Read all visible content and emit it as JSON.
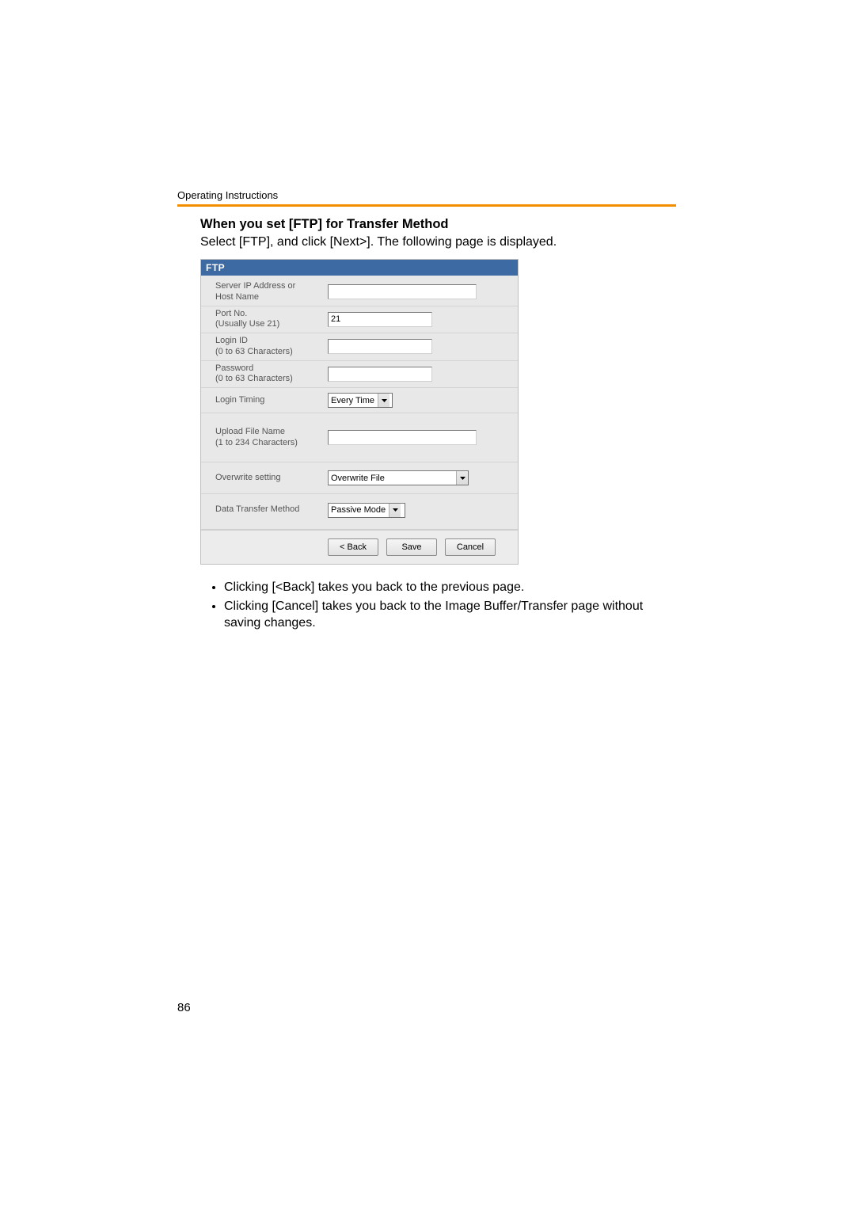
{
  "header": {
    "running_head": "Operating Instructions"
  },
  "section": {
    "title": "When you set [FTP] for Transfer Method",
    "subtitle": "Select [FTP], and click [Next>]. The following page is displayed."
  },
  "ftp": {
    "panel_title": "FTP",
    "rows": {
      "server": {
        "label_line1": "Server IP Address or",
        "label_line2": "Host Name",
        "value": ""
      },
      "port": {
        "label_line1": "Port No.",
        "label_line2": "(Usually Use 21)",
        "value": "21"
      },
      "login": {
        "label_line1": "Login ID",
        "label_line2": "(0 to 63 Characters)",
        "value": ""
      },
      "password": {
        "label_line1": "Password",
        "label_line2": "(0 to 63 Characters)",
        "value": ""
      },
      "timing": {
        "label": "Login Timing",
        "selected": "Every Time"
      },
      "upload": {
        "label_line1": "Upload File Name",
        "label_line2": "(1 to 234 Characters)",
        "value": ""
      },
      "overwrite": {
        "label": "Overwrite setting",
        "selected": "Overwrite File"
      },
      "method": {
        "label": "Data Transfer Method",
        "selected": "Passive Mode"
      }
    },
    "buttons": {
      "back": "< Back",
      "save": "Save",
      "cancel": "Cancel"
    }
  },
  "notes": {
    "item1": "Clicking [<Back] takes you back to the previous page.",
    "item2": "Clicking [Cancel] takes you back to the Image Buffer/Transfer page without saving changes."
  },
  "page_number": "86"
}
